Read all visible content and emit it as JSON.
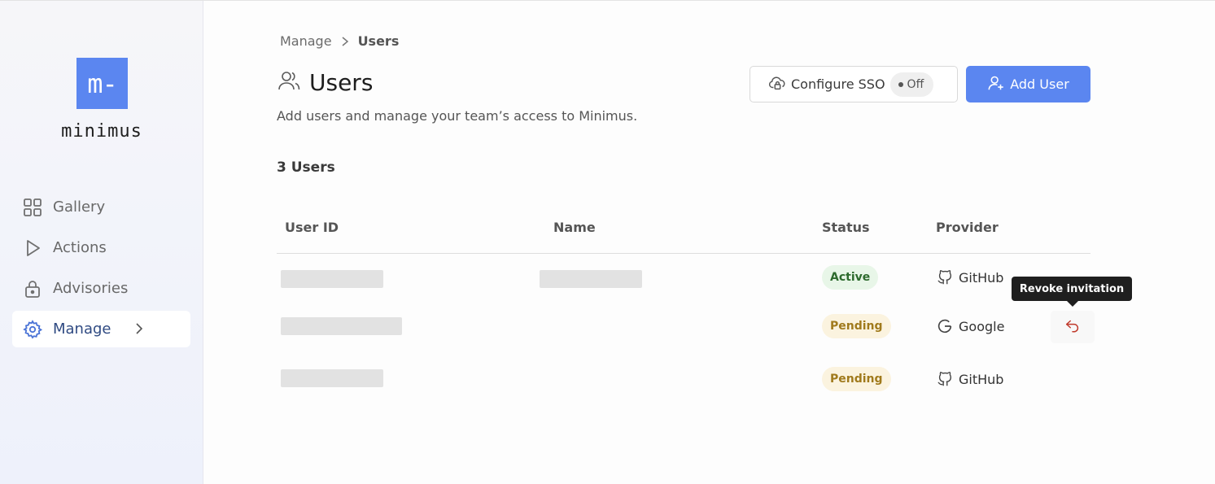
{
  "app": {
    "logo_mark": "m-",
    "logo_text": "minimus"
  },
  "sidebar": {
    "items": [
      {
        "label": "Gallery",
        "icon": "grid-icon"
      },
      {
        "label": "Actions",
        "icon": "play-icon"
      },
      {
        "label": "Advisories",
        "icon": "lock-icon"
      },
      {
        "label": "Manage",
        "icon": "gear-icon",
        "active": true
      }
    ]
  },
  "breadcrumb": {
    "parent": "Manage",
    "current": "Users"
  },
  "page": {
    "title": "Users",
    "subtitle": "Add users and manage your team’s access to Minimus.",
    "count_label": "3 Users"
  },
  "buttons": {
    "sso_label": "Configure SSO",
    "sso_status": "Off",
    "add_user_label": "Add User"
  },
  "table": {
    "headers": {
      "user_id": "User ID",
      "name": "Name",
      "status": "Status",
      "provider": "Provider"
    },
    "rows": [
      {
        "status": "Active",
        "provider": "GitHub"
      },
      {
        "status": "Pending",
        "provider": "Google"
      },
      {
        "status": "Pending",
        "provider": "GitHub"
      }
    ]
  },
  "tooltip": {
    "text": "Revoke invitation"
  },
  "colors": {
    "accent": "#5b86f0",
    "active_badge_bg": "#e8f6e8",
    "pending_badge_bg": "#fbf3df",
    "revoke_icon": "#c0392b"
  }
}
